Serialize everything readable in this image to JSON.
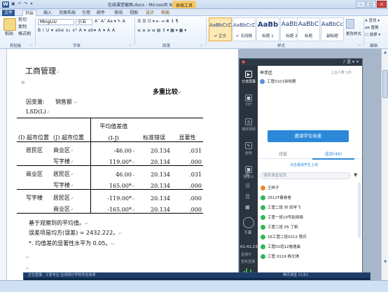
{
  "window": {
    "title": "在线课堂截图.docx - Microsoft Word",
    "context_tab": "表格工具",
    "qat": "▣ ↶ ↷ ▾",
    "app_icon": "W",
    "buttons": [
      "–",
      "□",
      "×"
    ]
  },
  "ribbon_tabs": [
    "文件",
    "开始",
    "插入",
    "页面布局",
    "引用",
    "邮件",
    "审阅",
    "视图",
    "设计",
    "布局"
  ],
  "ribbon": {
    "paste_label": "粘贴",
    "cut_label": "剪切",
    "copy_label": "复制",
    "format_painter_label": "格式刷",
    "font_name": "MingLiU",
    "font_size": "小五",
    "font_tools_row1": "A˄ A˅ Aa ▾ ✎ A",
    "font_tools_row2": "B I U ▾ abe x₂ x² A ▾ ab▾ A ▾ A A",
    "para_tools_row1": "☰ ☰ ☷ ▾ ⇤ ⇥ ✻ ↕ ¶",
    "para_tools_row2": "≡ ≡ ≡ ≡ ▤ ↕ ▾ ▦ ▾ ▦ ▾",
    "styles": [
      {
        "sample": "AaBbCcDd",
        "name": "↵ 正文"
      },
      {
        "sample": "AaBbCcDd",
        "name": "↵ 无间隔"
      },
      {
        "sample": "AaBb",
        "name": "标题 1"
      },
      {
        "sample": "AaBbC",
        "name": "标题 2"
      },
      {
        "sample": "AaBbC",
        "name": "标题"
      },
      {
        "sample": "AaBbCc",
        "name": "副标题"
      }
    ],
    "change_styles_label": "更改样式",
    "edit_items": [
      "A 查找 ▾",
      "ab 替换",
      "☐ 选择 ▾"
    ],
    "group_labels": [
      "剪贴板",
      "字体",
      "段落",
      "样式",
      "编辑"
    ],
    "group_expanders": [
      "⌐",
      "⌐",
      "⌐",
      "⌐"
    ]
  },
  "document": {
    "section_title": "工商管理",
    "table_title": "多重比较",
    "dependent_var_label": "因变量:",
    "dependent_var_value": "销售额",
    "method": "LSD(L)",
    "headers": {
      "col1": "(I) 超市位置",
      "col2": "(J) 超市位置",
      "col3_line1": "平均值差值",
      "col3_line2": "(I-J)",
      "col4": "标准错误",
      "col5": "显著性"
    },
    "rows": [
      {
        "i": "居民区",
        "j": "商业区",
        "diff": "-46.00",
        "se": "20.134",
        "sig": ".031"
      },
      {
        "i": "",
        "j": "写字楼",
        "diff": "119.00*",
        "se": "20.134",
        "sig": ".000"
      },
      {
        "i": "商业区",
        "j": "居民区",
        "diff": "46.00",
        "se": "20.134",
        "sig": ".031"
      },
      {
        "i": "",
        "j": "写字楼",
        "diff": "165.00*",
        "se": "20.134",
        "sig": ".000"
      },
      {
        "i": "写字楼",
        "j": "居民区",
        "diff": "-119.00*",
        "se": "20.134",
        "sig": ".000"
      },
      {
        "i": "",
        "j": "商业区",
        "diff": "-165.00*",
        "se": "20.134",
        "sig": ".000"
      }
    ],
    "note1": "基于观察到的平均值。",
    "note2": "误差项是均方(误差) = 2432.222。",
    "note3": "*. 均值差的显著性水平为 0.05。",
    "para_mark": "↵",
    "cell_mark": "↵",
    "anchor_mark": "⊕"
  },
  "class_panel": {
    "header_left": "●",
    "header_icons": "♪ 蓝 ▾ ✕",
    "area_label": "举手区",
    "online_label": "上台人数 1/6",
    "current_speaker": "工管0101徐彬雁",
    "invite_button": "邀请学生标麦",
    "tabs": [
      "讨论",
      "成员(46)"
    ],
    "invite_link": "点击邀请学生上线",
    "search_placeholder": "搜索课堂成员",
    "side_items": [
      {
        "icon": "▶",
        "label": "分享屏幕"
      },
      {
        "icon": "■",
        "label": "PPT"
      },
      {
        "icon": "◎",
        "label": "播放视频"
      },
      {
        "icon": "✎",
        "label": "画板"
      },
      {
        "icon": "■",
        "label": "摄像头"
      }
    ],
    "side_bottom": [
      "麦",
      "设",
      "音",
      "■"
    ],
    "end_label": "下课",
    "timer": "01:41:23",
    "live_label": "直播中",
    "live_sub": "查看直播",
    "members": [
      {
        "name": "王梓子",
        "color": "#f08a24"
      },
      {
        "name": "2512T春卷卷",
        "color": "#2fb75a"
      },
      {
        "name": "工管二班 刘 田学飞",
        "color": "#2fb75a"
      },
      {
        "name": "工管一班10号赵晓晓",
        "color": "#2fb75a"
      },
      {
        "name": "工管二班 05 丁帆",
        "color": "#2fb75a"
      },
      {
        "name": "16工管二班0212 程兵",
        "color": "#2fb75a"
      },
      {
        "name": "工管01班12施逸晨",
        "color": "#2fb75a"
      },
      {
        "name": "工管 0119 杨文琪",
        "color": "#2fb75a"
      }
    ]
  },
  "notice": {
    "text": "正在直播 · 工管专业·在线统计学软件应用课",
    "right": "腾讯课堂  21/62"
  },
  "colors": {
    "accent_blue": "#2b88d9",
    "panel_dark": "#2b333e",
    "doc_background": "#a7b6c8"
  }
}
